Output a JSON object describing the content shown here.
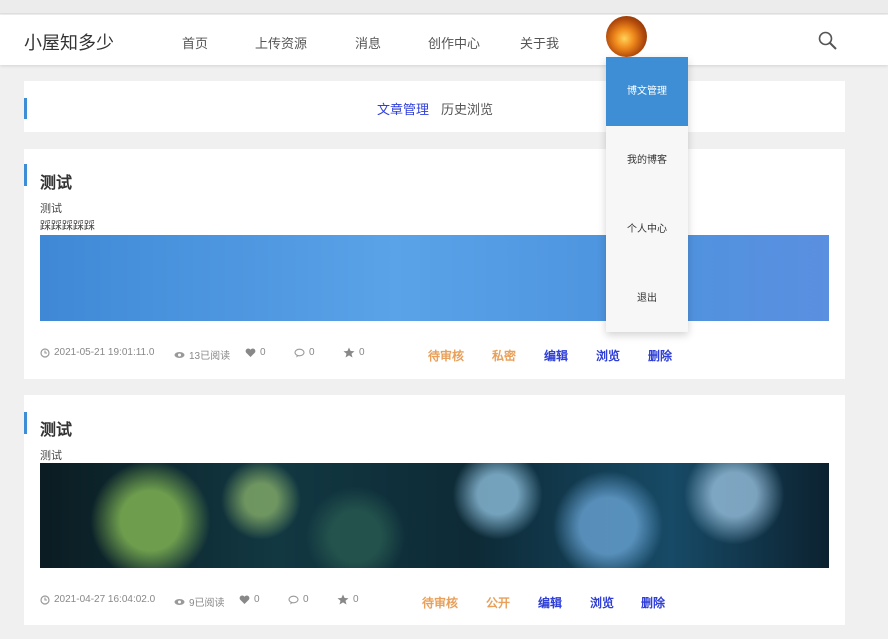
{
  "header": {
    "brand": "小屋知多少",
    "nav": [
      "首页",
      "上传资源",
      "消息",
      "创作中心",
      "关于我"
    ]
  },
  "dropdown": {
    "items": [
      "博文管理",
      "我的博客",
      "个人中心",
      "退出"
    ]
  },
  "tabs": {
    "manage": "文章管理",
    "history": "历史浏览"
  },
  "posts": [
    {
      "title": "测试",
      "summary": "测试",
      "summary2": "踩踩踩踩踩",
      "datetime": "2021-05-21 19:01:11.0",
      "views": "13已阅读",
      "likes": "0",
      "comments": "0",
      "stars": "0",
      "status": "待审核",
      "visibility": "私密",
      "edit": "编辑",
      "browse": "浏览",
      "delete": "删除"
    },
    {
      "title": "测试",
      "summary": "测试",
      "datetime": "2021-04-27 16:04:02.0",
      "views": "9已阅读",
      "likes": "0",
      "comments": "0",
      "stars": "0",
      "status": "待审核",
      "visibility": "公开",
      "edit": "编辑",
      "browse": "浏览",
      "delete": "删除"
    }
  ],
  "colors": {
    "accent": "#3d8ed4",
    "status": "#e8a05a",
    "action": "#2f3fd8"
  }
}
